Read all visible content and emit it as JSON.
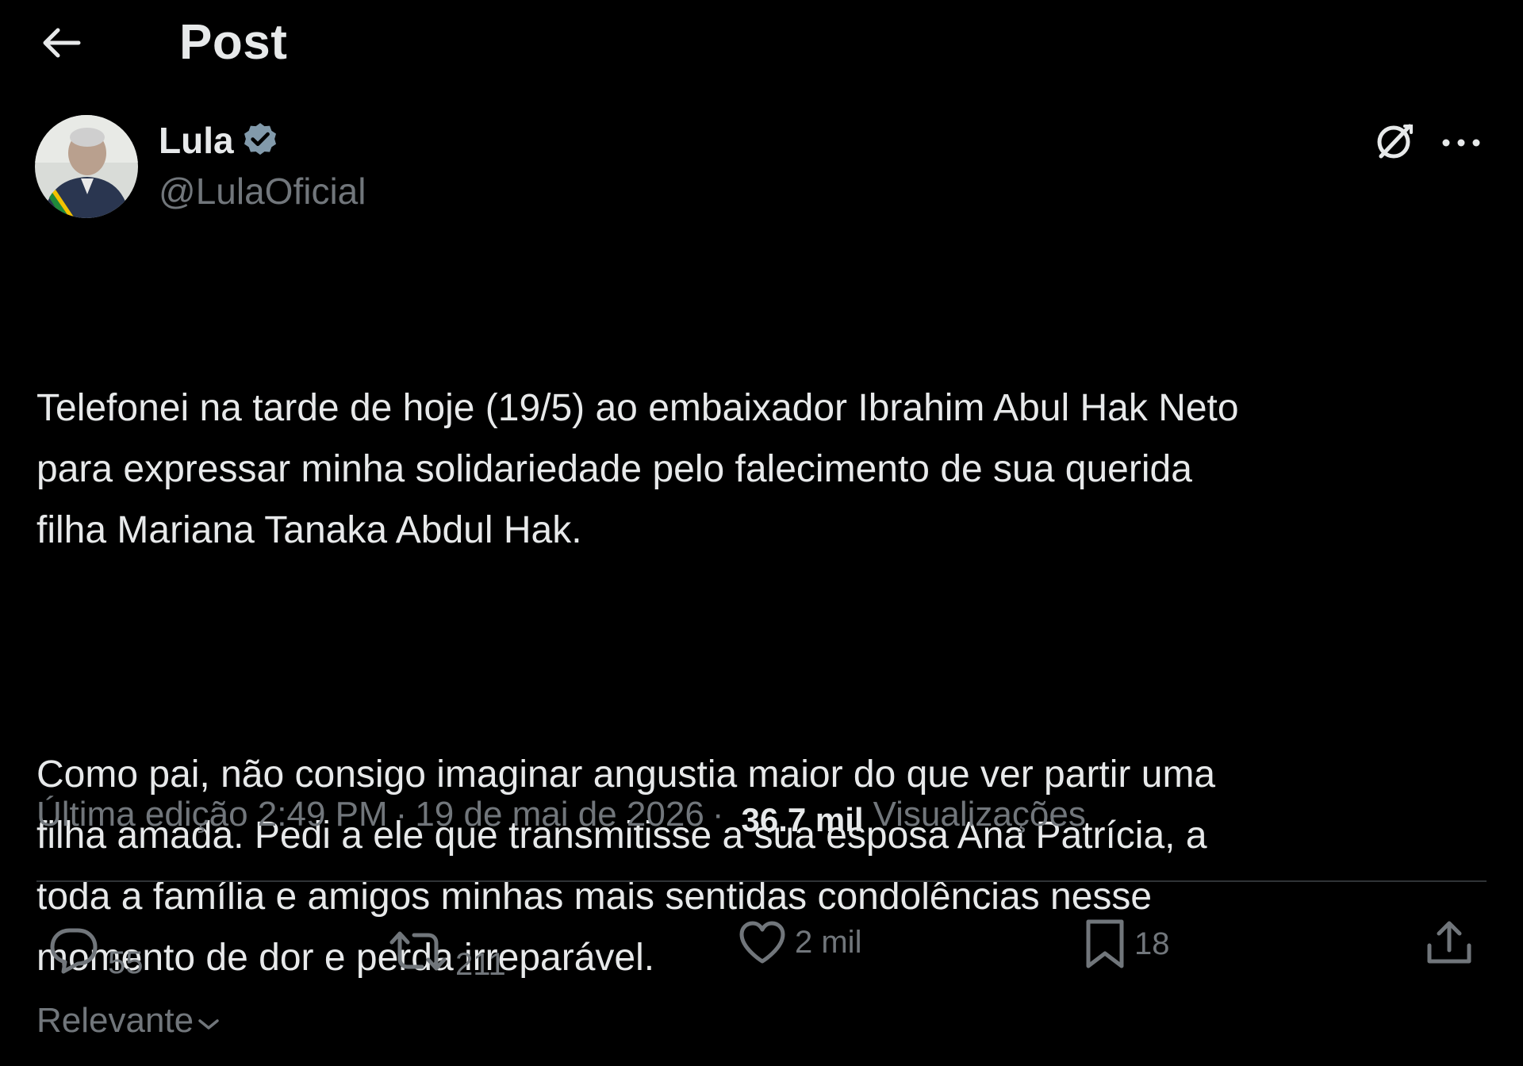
{
  "header": {
    "back_icon": "arrow-left-icon",
    "title": "Post"
  },
  "author": {
    "name": "Lula",
    "handle": "@LulaOficial",
    "verified_icon": "verified-badge-icon",
    "verified_color": "#829aab"
  },
  "post": {
    "paragraphs": [
      "Telefonei na tarde de hoje (19/5) ao embaixador Ibrahim Abul Hak Neto\npara expressar minha solidariedade pelo falecimento de sua querida\nfilha Mariana Tanaka Abdul Hak.",
      "Como pai, não consigo imaginar angustia maior do que ver partir uma\nfilha amada. Pedi a ele que transmitisse a sua esposa Ana Patrícia, a\ntoda a família e amigos minhas mais sentidas condolências nesse\nmomento de dor e perda irreparável."
    ],
    "meta": {
      "edited": "Última edição 2:49 PM",
      "separator": "·",
      "date": "19 de mai de 2026",
      "views_count": "36.7 mil",
      "views_label": "Visualizações"
    }
  },
  "actions": {
    "replies": "55",
    "reposts": "211",
    "likes": "2 mil",
    "bookmarks": "18"
  },
  "sort": {
    "label": "Relevante"
  },
  "colors": {
    "background": "#000000",
    "text": "#e7e9ea",
    "secondary": "#71767b",
    "divider": "#2f3336"
  }
}
